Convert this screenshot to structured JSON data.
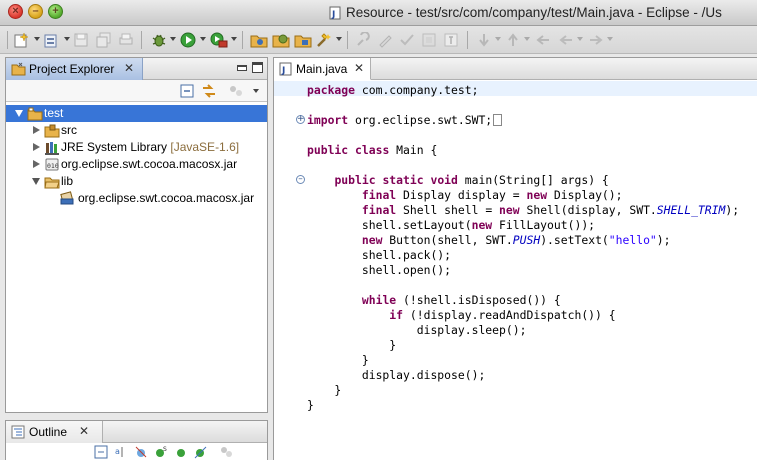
{
  "window": {
    "title": "Resource - test/src/com/company/test/Main.java - Eclipse - /Us",
    "buttons": [
      "close",
      "minimize",
      "zoom"
    ]
  },
  "toolbar": {
    "icons": [
      "new-icon",
      "new-dropdown-icon",
      "save-icon",
      "save-all-icon",
      "print-icon",
      "debug-icon",
      "run-icon",
      "external-tools-icon",
      "open-type-icon",
      "open-task-icon",
      "open-folder-icon",
      "search-icon",
      "annotation-icon",
      "next-annotation-icon",
      "prev-annotation-icon",
      "back-icon",
      "forward-icon"
    ]
  },
  "project_explorer": {
    "tab_label": "Project Explorer",
    "tree": [
      {
        "label": "test",
        "icon": "project-folder-icon",
        "expanded": true,
        "selected": true,
        "depth": 0
      },
      {
        "label": "src",
        "icon": "source-folder-icon",
        "expanded": false,
        "depth": 1
      },
      {
        "label": "JRE System Library",
        "suffix": "[JavaSE-1.6]",
        "icon": "library-icon",
        "expanded": false,
        "depth": 1
      },
      {
        "label": "org.eclipse.swt.cocoa.macosx.jar",
        "icon": "jar-icon",
        "expanded": false,
        "depth": 1
      },
      {
        "label": "lib",
        "icon": "folder-icon",
        "expanded": true,
        "depth": 1
      },
      {
        "label": "org.eclipse.swt.cocoa.macosx.jar",
        "icon": "jar-file-icon",
        "depth": 2
      }
    ]
  },
  "outline": {
    "tab_label": "Outline"
  },
  "editor": {
    "tab_label": "Main.java",
    "lines": [
      "package com.company.test;",
      "",
      "import org.eclipse.swt.SWT;",
      "",
      "public class Main {",
      "",
      "    public static void main(String[] args) {",
      "        final Display display = new Display();",
      "        final Shell shell = new Shell(display, SWT.SHELL_TRIM);",
      "        shell.setLayout(new FillLayout());",
      "        new Button(shell, SWT.PUSH).setText(\"hello\");",
      "        shell.pack();",
      "        shell.open();",
      "",
      "        while (!shell.isDisposed()) {",
      "            if (!display.readAndDispatch()) {",
      "                display.sleep();",
      "            }",
      "        }",
      "        display.dispose();",
      "    }",
      "}"
    ]
  },
  "colors": {
    "keyword": "#7f0055",
    "string": "#2a00ff",
    "constant": "#0000c0",
    "selection": "#3875d7",
    "current_line": "#e8f2fe"
  }
}
